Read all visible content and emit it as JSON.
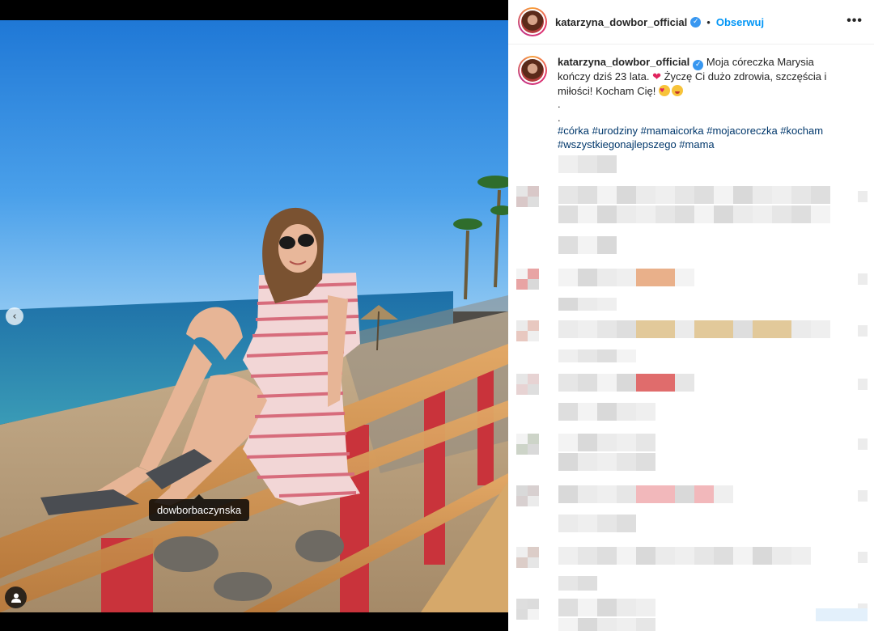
{
  "post": {
    "username": "katarzyna_dowbor_official",
    "verified_mark": "✓",
    "separator": "•",
    "follow_label": "Obserwuj",
    "more_label": "•••"
  },
  "caption": {
    "username": "katarzyna_dowbor_official",
    "text_part1": "Moja córeczka Marysia kończy dziś 23 lata.",
    "heart": "❤",
    "text_part2": "Życzę Ci dużo zdrowia, szczęścia i miłości! Kocham Cię!",
    "dot1": ".",
    "dot2": ".",
    "hashtags_line1": "#córka #urodziny #mamaicorka #mojacoreczka #kocham",
    "hashtags_line2": "#wszystkiegonajlepszego #mama"
  },
  "photo": {
    "tagged_user": "dowborbaczynska",
    "prev_arrow": "‹"
  },
  "icons": {
    "prev": "chevron-left-icon",
    "user_tag": "user-tag-icon",
    "more": "more-options-icon",
    "verified": "verified-badge-icon"
  },
  "colors": {
    "follow": "#0095f6",
    "hashtag": "#00376b",
    "verified": "#3897f0",
    "text": "#262626"
  }
}
